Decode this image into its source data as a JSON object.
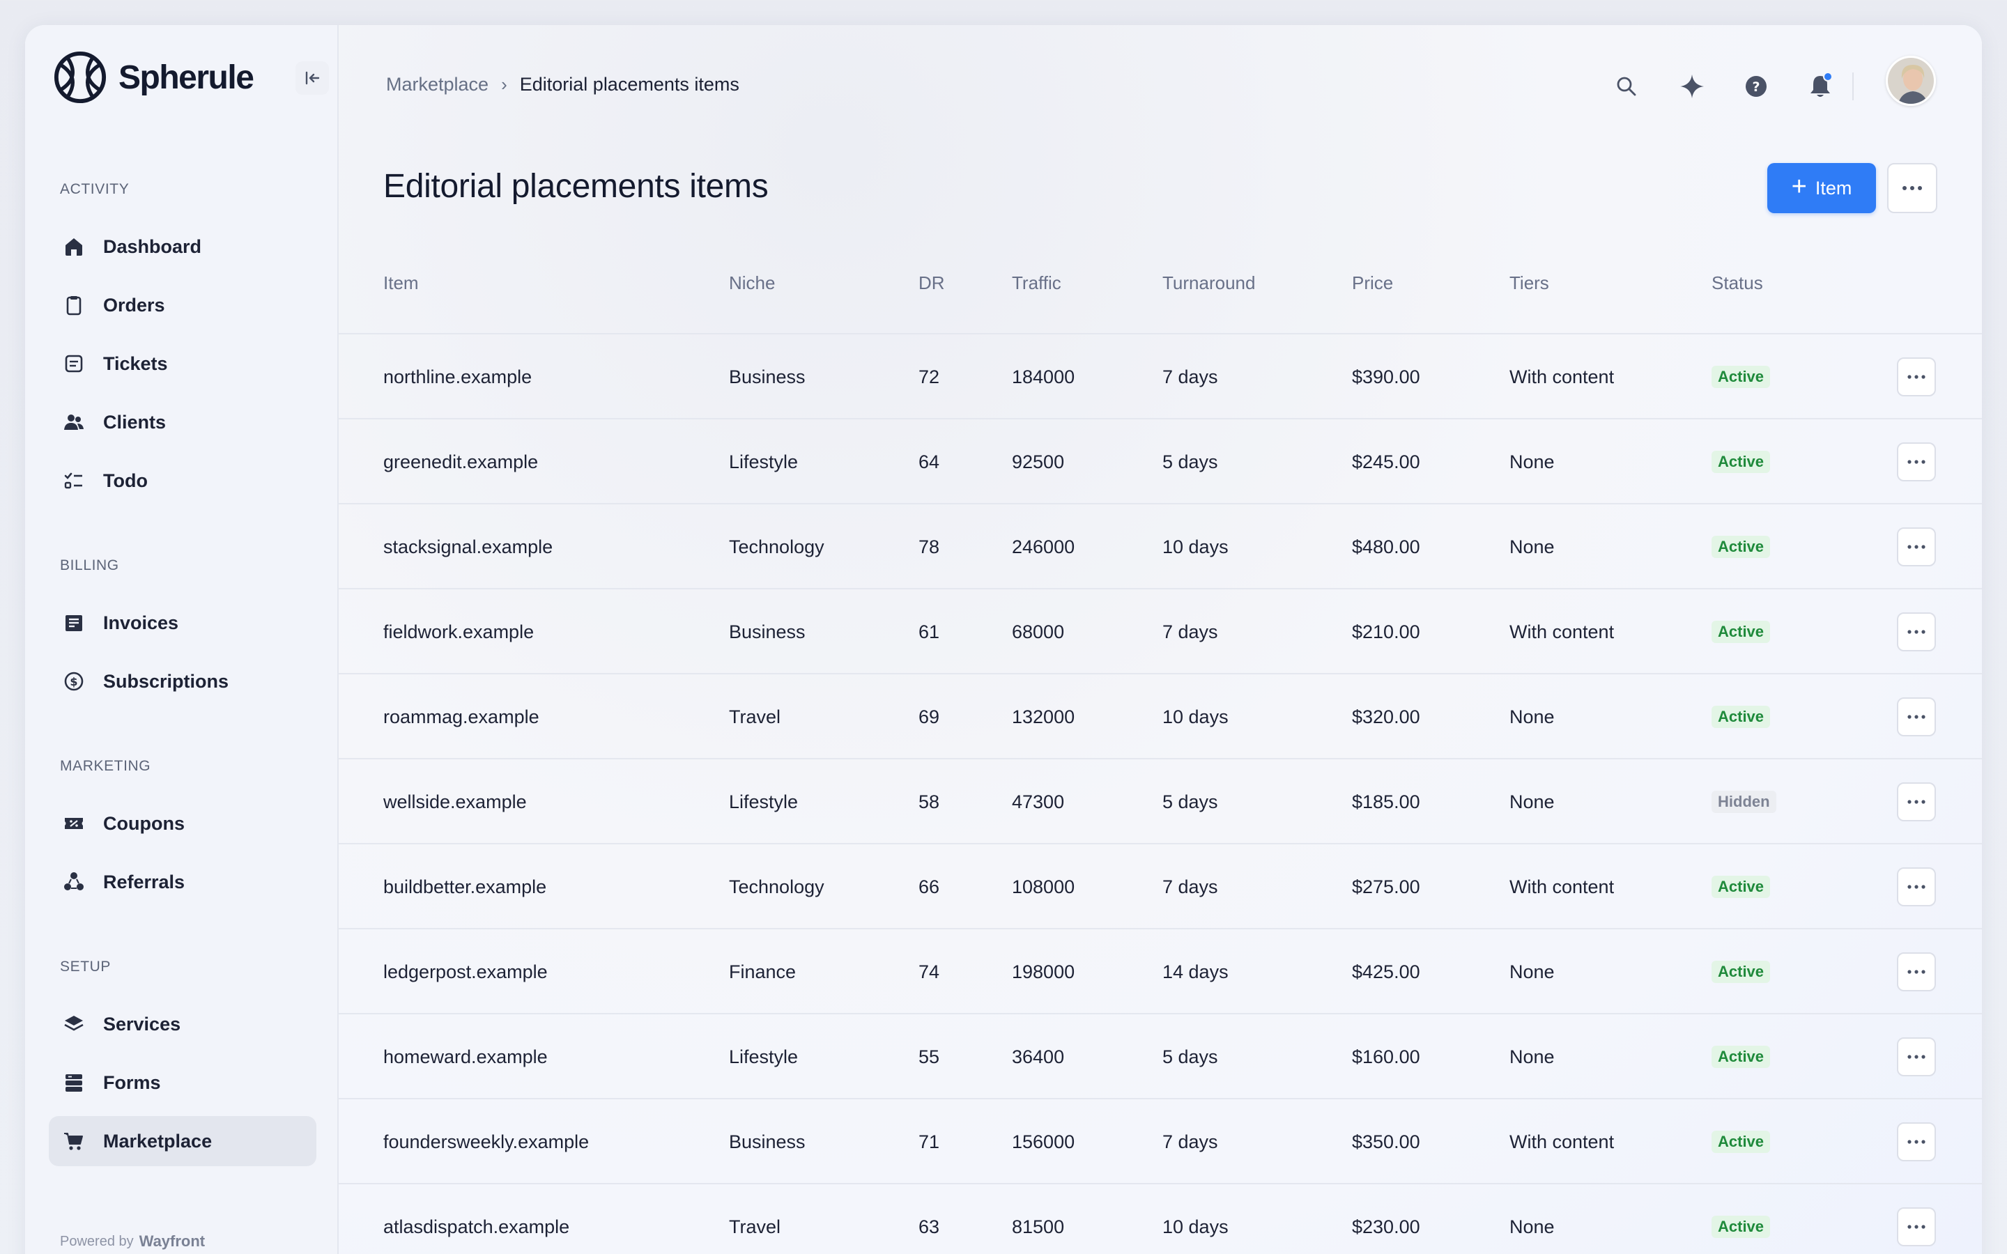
{
  "brand": {
    "name": "Spherule",
    "powered_prefix": "Powered by",
    "powered_brand": "Wayfront"
  },
  "sidebar": {
    "sections": [
      {
        "label": "ACTIVITY",
        "items": [
          {
            "label": "Dashboard",
            "icon": "home-icon"
          },
          {
            "label": "Orders",
            "icon": "clipboard-icon"
          },
          {
            "label": "Tickets",
            "icon": "ticket-icon"
          },
          {
            "label": "Clients",
            "icon": "users-icon"
          },
          {
            "label": "Todo",
            "icon": "checklist-icon"
          }
        ]
      },
      {
        "label": "BILLING",
        "items": [
          {
            "label": "Invoices",
            "icon": "invoice-icon"
          },
          {
            "label": "Subscriptions",
            "icon": "subscription-icon"
          }
        ]
      },
      {
        "label": "MARKETING",
        "items": [
          {
            "label": "Coupons",
            "icon": "coupon-icon"
          },
          {
            "label": "Referrals",
            "icon": "referral-icon"
          }
        ]
      },
      {
        "label": "SETUP",
        "items": [
          {
            "label": "Services",
            "icon": "layers-icon"
          },
          {
            "label": "Forms",
            "icon": "forms-icon"
          },
          {
            "label": "Marketplace",
            "icon": "cart-icon",
            "active": true
          }
        ]
      }
    ]
  },
  "header": {
    "breadcrumb": {
      "parent": "Marketplace",
      "separator": "›",
      "current": "Editorial placements items"
    },
    "icons": [
      "search-icon",
      "sparkle-icon",
      "help-icon",
      "bell-icon"
    ]
  },
  "page": {
    "title": "Editorial placements items",
    "add_button_label": "Item",
    "add_button_icon": "plus",
    "accent_color": "#2f7cf6"
  },
  "table": {
    "columns": [
      "Item",
      "Niche",
      "DR",
      "Traffic",
      "Turnaround",
      "Price",
      "Tiers",
      "Status"
    ],
    "rows": [
      {
        "item": "northline.example",
        "niche": "Business",
        "dr": "72",
        "traffic": "184000",
        "turnaround": "7 days",
        "price": "$390.00",
        "tiers": "With content",
        "status": "Active"
      },
      {
        "item": "greenedit.example",
        "niche": "Lifestyle",
        "dr": "64",
        "traffic": "92500",
        "turnaround": "5 days",
        "price": "$245.00",
        "tiers": "None",
        "status": "Active"
      },
      {
        "item": "stacksignal.example",
        "niche": "Technology",
        "dr": "78",
        "traffic": "246000",
        "turnaround": "10 days",
        "price": "$480.00",
        "tiers": "None",
        "status": "Active"
      },
      {
        "item": "fieldwork.example",
        "niche": "Business",
        "dr": "61",
        "traffic": "68000",
        "turnaround": "7 days",
        "price": "$210.00",
        "tiers": "With content",
        "status": "Active"
      },
      {
        "item": "roammag.example",
        "niche": "Travel",
        "dr": "69",
        "traffic": "132000",
        "turnaround": "10 days",
        "price": "$320.00",
        "tiers": "None",
        "status": "Active"
      },
      {
        "item": "wellside.example",
        "niche": "Lifestyle",
        "dr": "58",
        "traffic": "47300",
        "turnaround": "5 days",
        "price": "$185.00",
        "tiers": "None",
        "status": "Hidden"
      },
      {
        "item": "buildbetter.example",
        "niche": "Technology",
        "dr": "66",
        "traffic": "108000",
        "turnaround": "7 days",
        "price": "$275.00",
        "tiers": "With content",
        "status": "Active"
      },
      {
        "item": "ledgerpost.example",
        "niche": "Finance",
        "dr": "74",
        "traffic": "198000",
        "turnaround": "14 days",
        "price": "$425.00",
        "tiers": "None",
        "status": "Active"
      },
      {
        "item": "homeward.example",
        "niche": "Lifestyle",
        "dr": "55",
        "traffic": "36400",
        "turnaround": "5 days",
        "price": "$160.00",
        "tiers": "None",
        "status": "Active"
      },
      {
        "item": "foundersweekly.example",
        "niche": "Business",
        "dr": "71",
        "traffic": "156000",
        "turnaround": "7 days",
        "price": "$350.00",
        "tiers": "With content",
        "status": "Active"
      },
      {
        "item": "atlasdispatch.example",
        "niche": "Travel",
        "dr": "63",
        "traffic": "81500",
        "turnaround": "10 days",
        "price": "$230.00",
        "tiers": "None",
        "status": "Active"
      }
    ]
  }
}
